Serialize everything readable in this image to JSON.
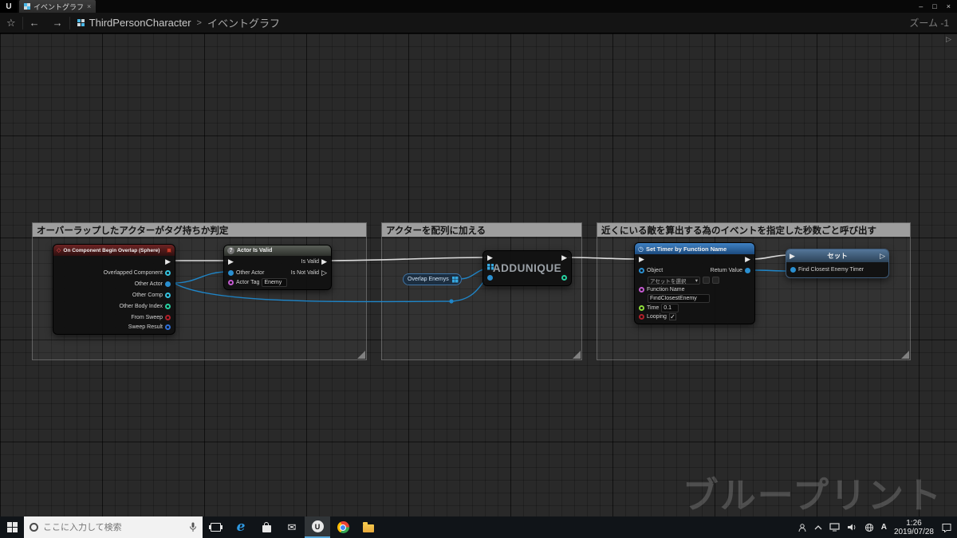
{
  "titlebar": {
    "tab": {
      "label": "イベントグラフ",
      "close_glyph": "×"
    },
    "controls": {
      "minimize": "–",
      "maximize": "□",
      "close": "×"
    }
  },
  "toolbar": {
    "favorite_glyph": "☆",
    "back_glyph": "←",
    "forward_glyph": "→",
    "breadcrumb": {
      "root": "ThirdPersonCharacter",
      "separator": ">",
      "current": "イベントグラフ"
    },
    "zoom": "ズーム -1",
    "side_arrow_glyph": "▷"
  },
  "graph": {
    "comments": [
      {
        "title": "オーバーラップしたアクターがタグ持ちか判定"
      },
      {
        "title": "アクターを配列に加える"
      },
      {
        "title": "近くにいる敵を算出する為のイベントを指定した秒数ごと呼び出す"
      }
    ],
    "event_node": {
      "title": "On Component Begin Overlap (Sphere)",
      "pins": [
        "Overlapped Component",
        "Other Actor",
        "Other Comp",
        "Other Body Index",
        "From Sweep",
        "Sweep Result"
      ]
    },
    "is_valid_node": {
      "icon_glyph": "?",
      "title": "Actor Is Valid",
      "exec_out_valid": "Is Valid",
      "exec_out_invalid": "Is Not Valid",
      "input_actor": "Other Actor",
      "input_tag": "Actor Tag",
      "tag_value": "Enemy"
    },
    "var_node": {
      "label": "Overlap Enemys"
    },
    "add_unique_node": {
      "title": "ADDUNIQUE"
    },
    "set_timer_node": {
      "icon_glyph": "◷",
      "title": "Set Timer by Function Name",
      "object_label": "Object",
      "object_picker": "アセットを選択",
      "picker_caret": "▾",
      "function_name_label": "Function Name",
      "function_name_value": "FindClosestEnemy",
      "time_label": "Time",
      "time_value": "0.1",
      "looping_label": "Looping",
      "checkbox_glyph": "✓",
      "return_value_label": "Return Value"
    },
    "set_node": {
      "title": "セット",
      "pin_label": "Find Closest Enemy Timer"
    },
    "watermark": "ブループリント"
  },
  "taskbar": {
    "search_placeholder": "ここに入力して検索",
    "ime_indicator": "A",
    "clock": {
      "time": "1:26",
      "date": "2019/07/28"
    }
  },
  "colors": {
    "exec_wire": "#dcdcdc",
    "data_wire": "#1f86c9",
    "object_pin": "#2a8fd0",
    "component_pin": "#35c3e0",
    "int_pin": "#27d0a0",
    "bool_pin": "#b0202a",
    "name_pin": "#c45ad0",
    "float_pin": "#8ddc3a",
    "struct_pin": "#2f6fd8",
    "timer_header": "#2e6da4",
    "event_header": "#6e2424",
    "comment_header": "#9e9e9e"
  }
}
